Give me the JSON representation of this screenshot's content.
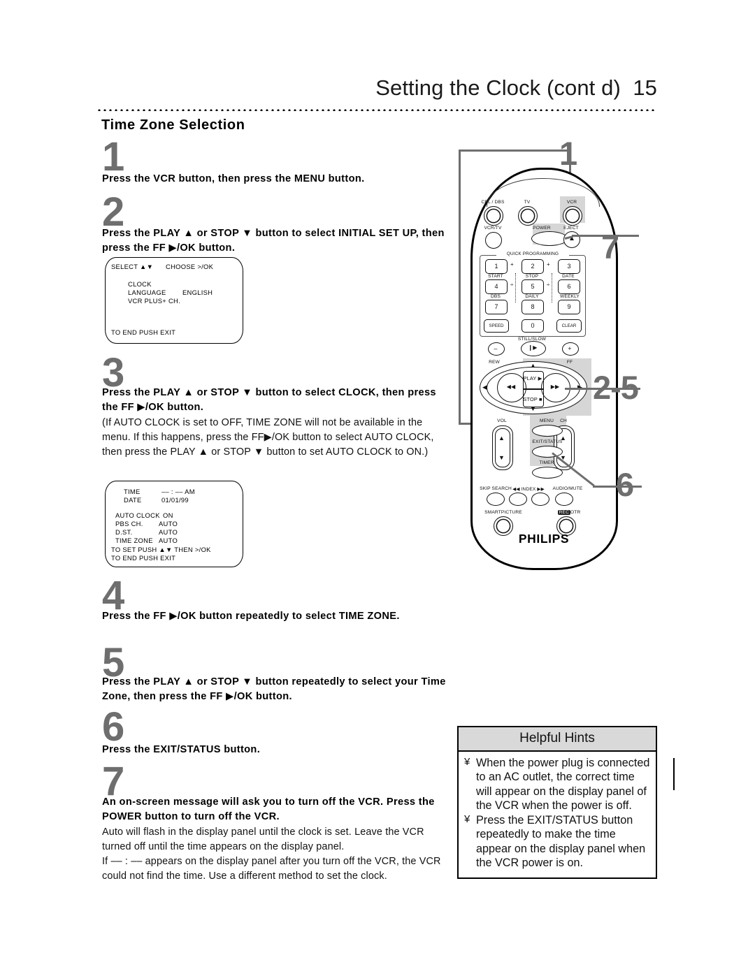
{
  "header": {
    "title": "Setting the Clock (cont d)",
    "page_number": "15",
    "section_title": "Time Zone Selection"
  },
  "steps": [
    {
      "num": "1",
      "bold": "Press the VCR button, then press the MENU button.",
      "plain": ""
    },
    {
      "num": "2",
      "bold": "Press the PLAY ▲ or STOP ▼ button to select INITIAL SET UP, then press the FF ▶/OK button.",
      "plain": ""
    },
    {
      "num": "3",
      "bold": "Press the PLAY ▲ or STOP ▼ button to select CLOCK, then press the FF ▶/OK button.",
      "plain": "(If AUTO CLOCK is set to OFF, TIME ZONE will not be available in the menu. If this happens, press the FF▶/OK button to select AUTO CLOCK, then press the PLAY ▲ or STOP ▼ button to set AUTO CLOCK to ON.)"
    },
    {
      "num": "4",
      "bold": "Press the FF ▶/OK button repeatedly to select TIME ZONE.",
      "plain": ""
    },
    {
      "num": "5",
      "bold": "Press the PLAY ▲ or STOP ▼ button repeatedly to select your Time Zone, then press the FF ▶/OK button.",
      "plain": ""
    },
    {
      "num": "6",
      "bold": "Press the EXIT/STATUS button.",
      "plain": ""
    },
    {
      "num": "7",
      "bold": "An on-screen message will ask you to turn off the VCR. Press the POWER button to turn off the VCR.",
      "plain": "Auto will flash in the display panel until the clock is set. Leave the VCR turned off until the time appears on the display panel.\nIf –– : –– appears on the display panel after you turn off the VCR, the VCR could not find the time. Use a different method to set the clock."
    }
  ],
  "osd_menu_1": {
    "select_label": "SELECT ▲▼",
    "choose_label": "CHOOSE >/OK",
    "rows": [
      {
        "name": "CLOCK",
        "value": ""
      },
      {
        "name": "LANGUAGE",
        "value": "ENGLISH"
      },
      {
        "name": "VCR PLUS+ CH.",
        "value": ""
      }
    ],
    "footer": "TO END PUSH EXIT"
  },
  "osd_menu_2": {
    "rows": [
      {
        "name": "TIME",
        "value": "–– : –– AM"
      },
      {
        "name": "DATE",
        "value": "01/01/99"
      }
    ],
    "settings": [
      {
        "name": "AUTO CLOCK",
        "value": "ON"
      },
      {
        "name": "PBS CH.",
        "value": "AUTO"
      },
      {
        "name": "D.ST.",
        "value": "AUTO"
      },
      {
        "name": "TIME ZONE",
        "value": "AUTO"
      }
    ],
    "footer1": "TO SET PUSH ▲▼ THEN >/OK",
    "footer2": "TO END PUSH EXIT"
  },
  "remote": {
    "brand": "PHILIPS",
    "source_buttons": [
      "CBL / DBS",
      "TV",
      "VCR"
    ],
    "row2_buttons": [
      "VCR/TV",
      "POWER",
      "EJECT"
    ],
    "quick_programming_label": "QUICK PROGRAMMING",
    "keypad": [
      {
        "key": "1",
        "sub": "START"
      },
      {
        "key": "2",
        "sub": "STOP"
      },
      {
        "key": "3",
        "sub": "DATE"
      },
      {
        "key": "4",
        "sub": "DBS"
      },
      {
        "key": "5",
        "sub": "DAILY"
      },
      {
        "key": "6",
        "sub": "WEEKLY"
      },
      {
        "key": "7",
        "sub": ""
      },
      {
        "key": "8",
        "sub": ""
      },
      {
        "key": "9",
        "sub": ""
      },
      {
        "key": "SPEED",
        "sub": ""
      },
      {
        "key": "0",
        "sub": ""
      },
      {
        "key": "CLEAR",
        "sub": ""
      }
    ],
    "still_slow_label": "STILL/SLOW",
    "minus_label": "–",
    "plus_label": "+",
    "transport": {
      "rew_label": "REW",
      "ff_label": "FF",
      "play_label": "PLAY ▶",
      "stop_label": "STOP ■",
      "rew_glyph": "◀◀",
      "ff_glyph": "▶▶"
    },
    "vol_label": "VOL",
    "ch_label": "CH",
    "menu_label": "MENU",
    "exit_status_label": "EXIT/STATUS",
    "timer_label": "TIMER",
    "bottom_row": [
      "SKIP SEARCH",
      "◀◀ INDEX ▶▶",
      "AUDIO/MUTE"
    ],
    "smartpicture_label": "SMARTPICTURE",
    "otr_label": "OTR",
    "rec_label": "REC"
  },
  "callouts": [
    {
      "label": "1"
    },
    {
      "label": "7"
    },
    {
      "label": "2-5"
    },
    {
      "label": "6"
    }
  ],
  "hints": {
    "title": "Helpful Hints",
    "bullet": "¥",
    "items": [
      "When the power plug is connected to an AC outlet, the correct time will appear on the display panel of the VCR when the power is off.",
      "Press the EXIT/STATUS button repeatedly to make the time appear on the display panel when the VCR power is on."
    ]
  },
  "colors": {
    "step_number": "#6e6e6e",
    "hints_header_bg": "#d9d9d9",
    "highlight": "#d6d6d6"
  }
}
